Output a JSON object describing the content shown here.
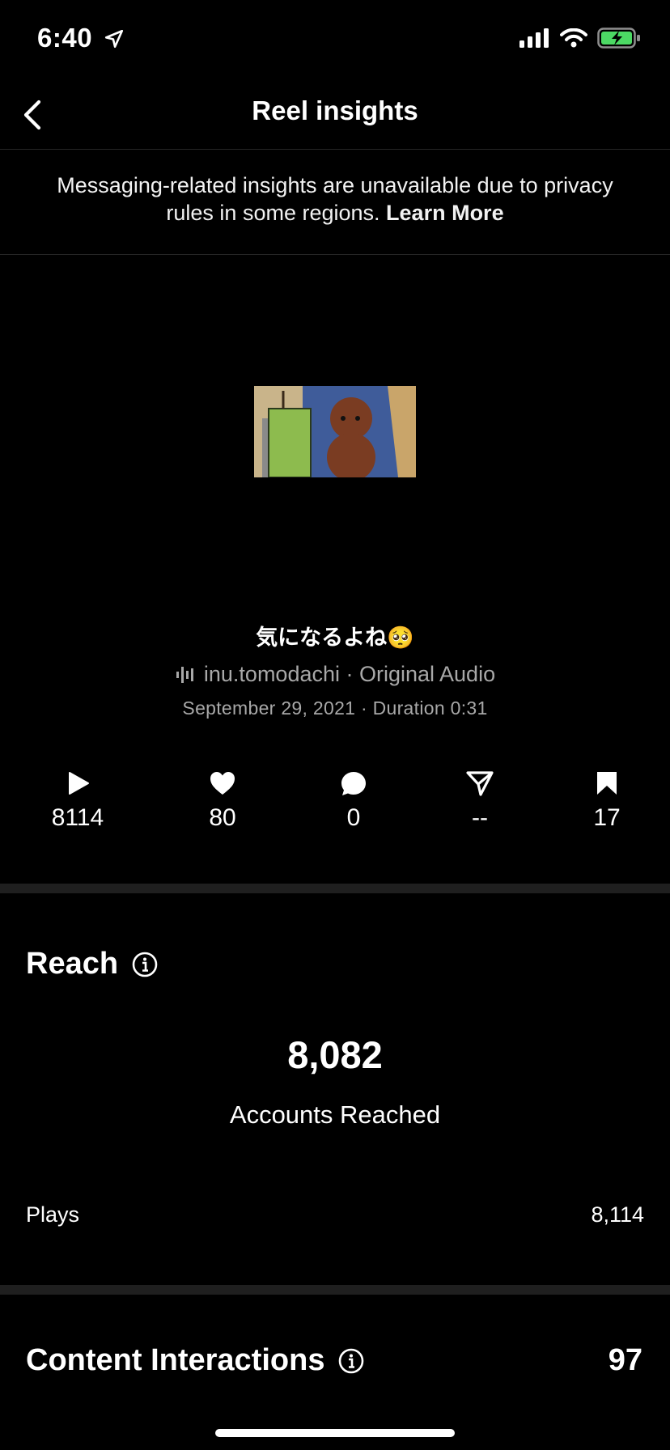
{
  "status_bar": {
    "time": "6:40"
  },
  "nav": {
    "title": "Reel insights"
  },
  "notice": {
    "text": "Messaging-related insights are unavailable due to privacy rules in some regions.",
    "link": "Learn More"
  },
  "reel": {
    "caption": "気になるよね🥺",
    "audio": "inu.tomodachi · Original Audio",
    "date_duration": "September 29, 2021 · Duration 0:31"
  },
  "stats": [
    {
      "icon": "play-icon",
      "value": "8114"
    },
    {
      "icon": "heart-icon",
      "value": "80"
    },
    {
      "icon": "comment-icon",
      "value": "0"
    },
    {
      "icon": "share-icon",
      "value": "--"
    },
    {
      "icon": "bookmark-icon",
      "value": "17"
    }
  ],
  "reach": {
    "title": "Reach",
    "accounts_reached": "8,082",
    "accounts_label": "Accounts Reached",
    "plays_label": "Plays",
    "plays_value": "8,114"
  },
  "content_interactions": {
    "title": "Content Interactions",
    "value": "97"
  },
  "colors": {
    "background": "#000000",
    "secondary_text": "#a8a8a8",
    "divider": "#262626"
  }
}
